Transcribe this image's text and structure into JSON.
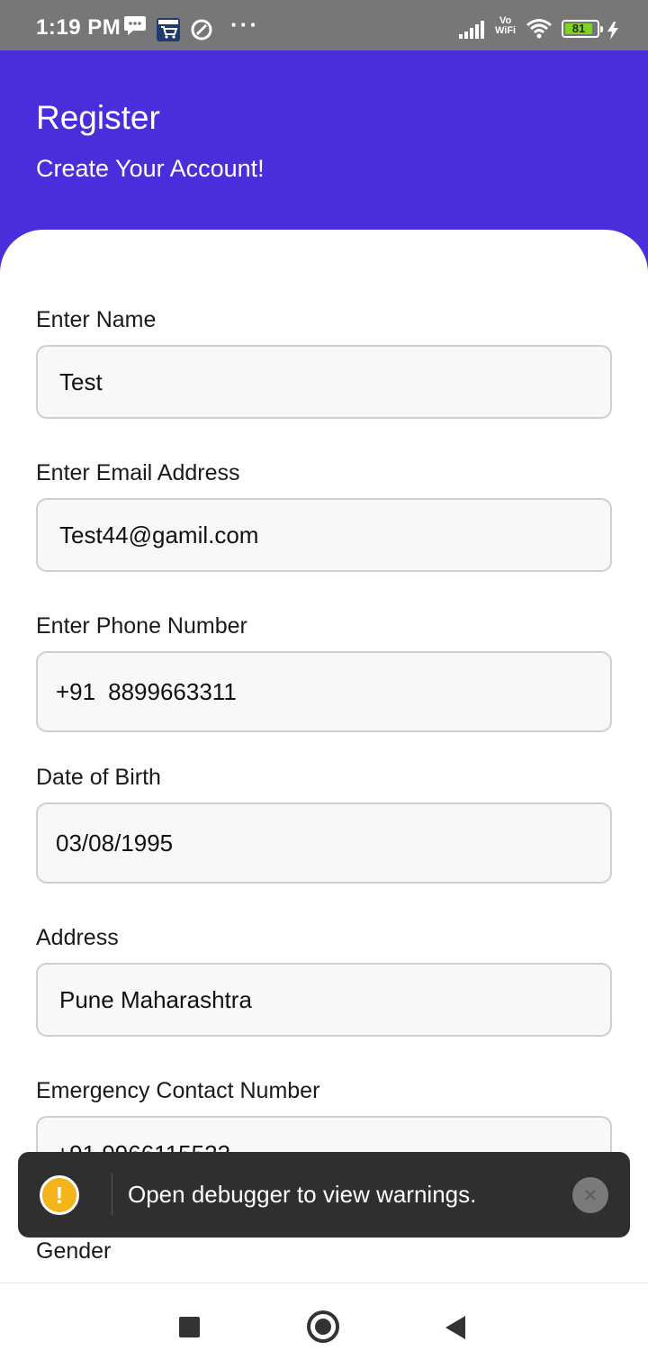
{
  "status_bar": {
    "time": "1:19 PM",
    "dots": "···",
    "vowifi_top": "Vo",
    "vowifi_bottom": "WiFi",
    "battery": "81",
    "icons": [
      "message-icon",
      "amazon-cart-icon",
      "sync-icon",
      "signal-icon",
      "wifi-icon",
      "battery-icon",
      "charging-icon"
    ]
  },
  "header": {
    "title": "Register",
    "subtitle": "Create Your Account!"
  },
  "form": {
    "name_label": "Enter Name",
    "name_value": "Test",
    "email_label": "Enter Email Address",
    "email_value": "Test44@gamil.com",
    "phone_label": "Enter Phone Number",
    "phone_prefix": "+91",
    "phone_value": "8899663311",
    "dob_label": "Date of Birth",
    "dob_value": "03/08/1995",
    "address_label": "Address",
    "address_value": "Pune Maharashtra",
    "emergency_label": "Emergency Contact Number",
    "emergency_value": "+91  9966115522",
    "gender_label": "Gender"
  },
  "toast": {
    "icon": "!",
    "message": "Open debugger to view warnings.",
    "close": "✕"
  },
  "colors": {
    "header_bg": "#4a2ddb",
    "status_bar_bg": "#777777",
    "toast_bg": "#2f2f2f",
    "warning": "#f4b41a"
  }
}
